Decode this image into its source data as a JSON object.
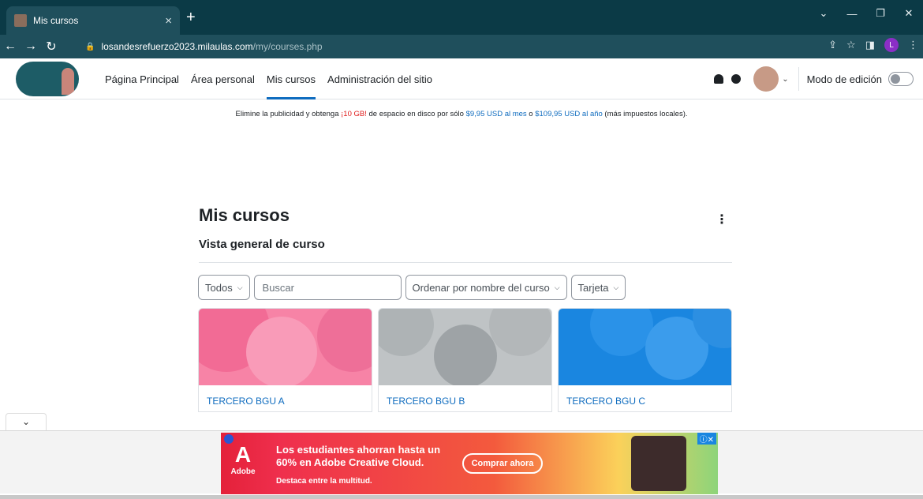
{
  "browser": {
    "tab_title": "Mis cursos",
    "new_tab": "+",
    "url_host": "losandesrefuerzo2023.milaulas.com",
    "url_path": "/my/courses.php",
    "profile_initial": "L"
  },
  "navbar": {
    "links": [
      "Página Principal",
      "Área personal",
      "Mis cursos",
      "Administración del sitio"
    ],
    "edit_mode_label": "Modo de edición"
  },
  "ad_notice": {
    "part1": "Elimine la publicidad y obtenga ",
    "highlight": "¡10 GB!",
    "part2": " de espacio en disco por sólo ",
    "price_month": "$9,95 USD al mes",
    "part3": " o ",
    "price_year": "$109,95 USD al año",
    "part4": " (más impuestos locales)."
  },
  "main": {
    "title": "Mis cursos",
    "block_title": "Vista general de curso",
    "filter_all": "Todos",
    "search_placeholder": "Buscar",
    "sort_label": "Ordenar por nombre del curso",
    "view_label": "Tarjeta"
  },
  "courses": [
    {
      "title": "TERCERO BGU A",
      "color": "#f783a6"
    },
    {
      "title": "TERCERO BGU B",
      "color": "#bfc3c5"
    },
    {
      "title": "TERCERO BGU C",
      "color": "#1a86e0"
    }
  ],
  "ad_banner": {
    "brand": "Adobe",
    "headline_1": "Los estudiantes ahorran hasta un",
    "headline_2": "60% en Adobe Creative Cloud.",
    "sub": "Destaca entre la multitud.",
    "cta": "Comprar ahora"
  }
}
